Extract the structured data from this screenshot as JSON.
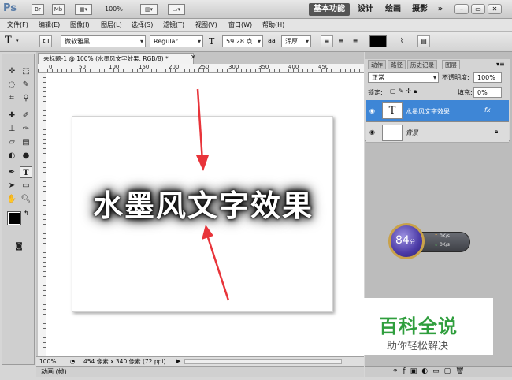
{
  "app": {
    "logo": "Ps",
    "zoom": "100%",
    "icons": [
      "Br",
      "Mb"
    ],
    "workspaces": [
      "基本功能",
      "设计",
      "绘画",
      "摄影"
    ],
    "more": "»"
  },
  "menu": [
    "文件(F)",
    "编辑(E)",
    "图像(I)",
    "图层(L)",
    "选择(S)",
    "滤镜(T)",
    "视图(V)",
    "窗口(W)",
    "帮助(H)"
  ],
  "options": {
    "tool_glyph": "T",
    "font_family": "微软雅黑",
    "font_style": "Regular",
    "font_size": "59.28 点",
    "aa_label": "a",
    "aa_mode": "浑厚"
  },
  "document": {
    "tab_title": "未标题-1 @ 100% (水墨风文字效果, RGB/8) *",
    "canvas_text": "水墨风文字效果",
    "zoom": "100%",
    "dimensions": "454 像素 x 340 像素 (72 ppi)",
    "ruler": [
      "0",
      "50",
      "100",
      "150",
      "200",
      "250",
      "300",
      "350",
      "400",
      "450"
    ]
  },
  "panels": {
    "tabs": [
      "动作",
      "路径",
      "历史记录",
      "图层"
    ],
    "blend_mode": "正常",
    "opacity_label": "不透明度:",
    "opacity": "100%",
    "lock_label": "锁定:",
    "fill_label": "填充:",
    "fill": "0%",
    "layers": [
      {
        "name": "水墨风文字效果",
        "thumb": "T",
        "fx": "fx"
      },
      {
        "name": "背景",
        "thumb": ""
      }
    ]
  },
  "animation": {
    "label": "动画 (帧)"
  },
  "widget": {
    "score": "84",
    "unit": "分",
    "up": "0K/s",
    "down": "0K/s"
  },
  "watermark": {
    "title": "百科全说",
    "subtitle": "助你轻松解决"
  },
  "colors": {
    "accent": "#3e86d6",
    "arrow": "#e8343a"
  }
}
